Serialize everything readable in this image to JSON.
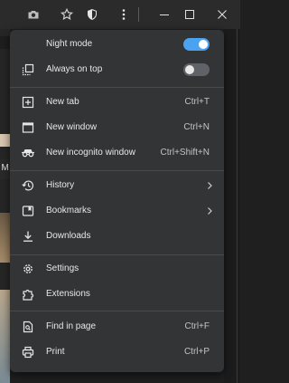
{
  "colors": {
    "menu_bg": "#333436",
    "text": "#e8e8e8",
    "shortcut": "#c4c4c4",
    "accent": "#4aa3f0",
    "toggle_off": "#5f6368",
    "topbar": "#2b2b2b"
  },
  "toolbar": {
    "icons": [
      "camera-icon",
      "star-icon",
      "shield-icon",
      "more-vert-icon",
      "minimize-icon",
      "maximize-icon",
      "close-icon"
    ]
  },
  "background": {
    "partial_text": "t M"
  },
  "menu": {
    "toggles": [
      {
        "label": "Night mode",
        "icon": "crescent-moon-icon",
        "on": true
      },
      {
        "label": "Always on top",
        "icon": "window-on-top-icon",
        "on": false
      }
    ],
    "windows": [
      {
        "label": "New tab",
        "icon": "new-tab-icon",
        "shortcut": "Ctrl+T"
      },
      {
        "label": "New window",
        "icon": "new-window-icon",
        "shortcut": "Ctrl+N"
      },
      {
        "label": "New incognito window",
        "icon": "incognito-icon",
        "shortcut": "Ctrl+Shift+N"
      }
    ],
    "library": [
      {
        "label": "History",
        "icon": "history-icon",
        "submenu": true
      },
      {
        "label": "Bookmarks",
        "icon": "bookmarks-icon",
        "submenu": true
      },
      {
        "label": "Downloads",
        "icon": "download-icon",
        "submenu": false
      }
    ],
    "tools": [
      {
        "label": "Settings",
        "icon": "gear-icon"
      },
      {
        "label": "Extensions",
        "icon": "puzzle-icon"
      }
    ],
    "page": [
      {
        "label": "Find in page",
        "icon": "find-in-page-icon",
        "shortcut": "Ctrl+F"
      },
      {
        "label": "Print",
        "icon": "printer-icon",
        "shortcut": "Ctrl+P"
      }
    ]
  }
}
